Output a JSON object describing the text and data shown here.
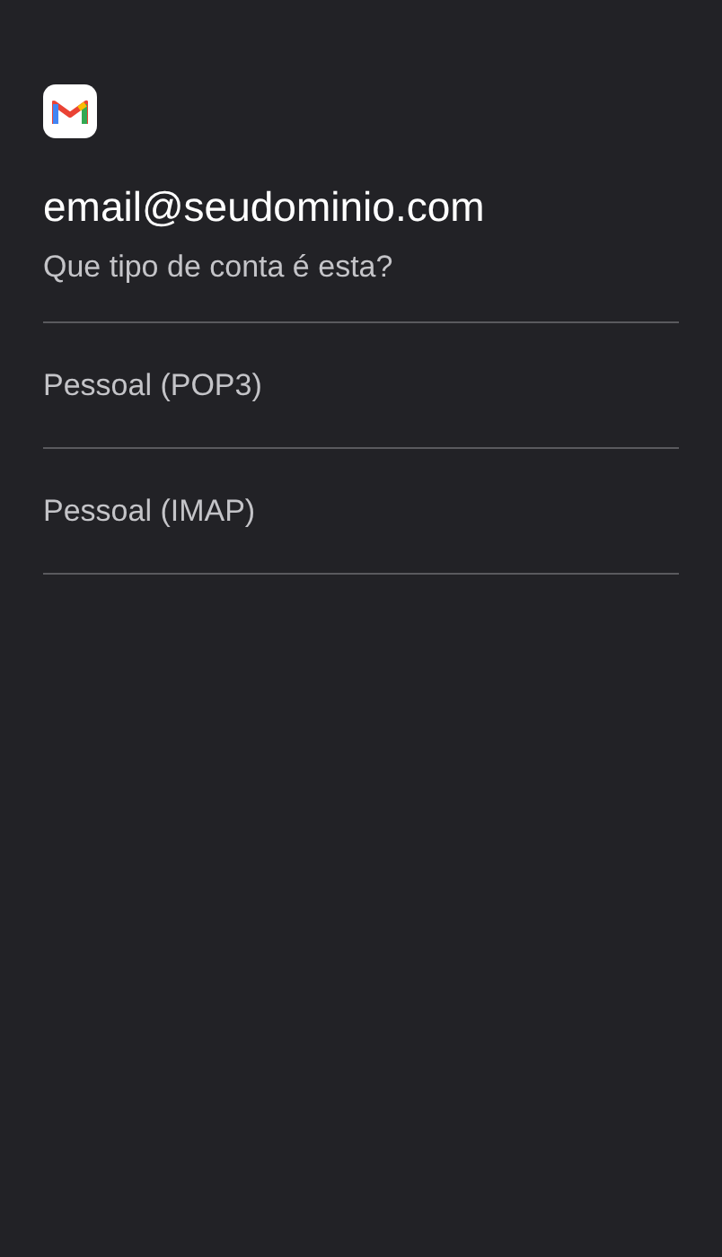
{
  "account": {
    "email": "email@seudominio.com",
    "question": "Que tipo de conta é esta?"
  },
  "options": [
    {
      "label": "Pessoal (POP3)"
    },
    {
      "label": "Pessoal (IMAP)"
    }
  ]
}
